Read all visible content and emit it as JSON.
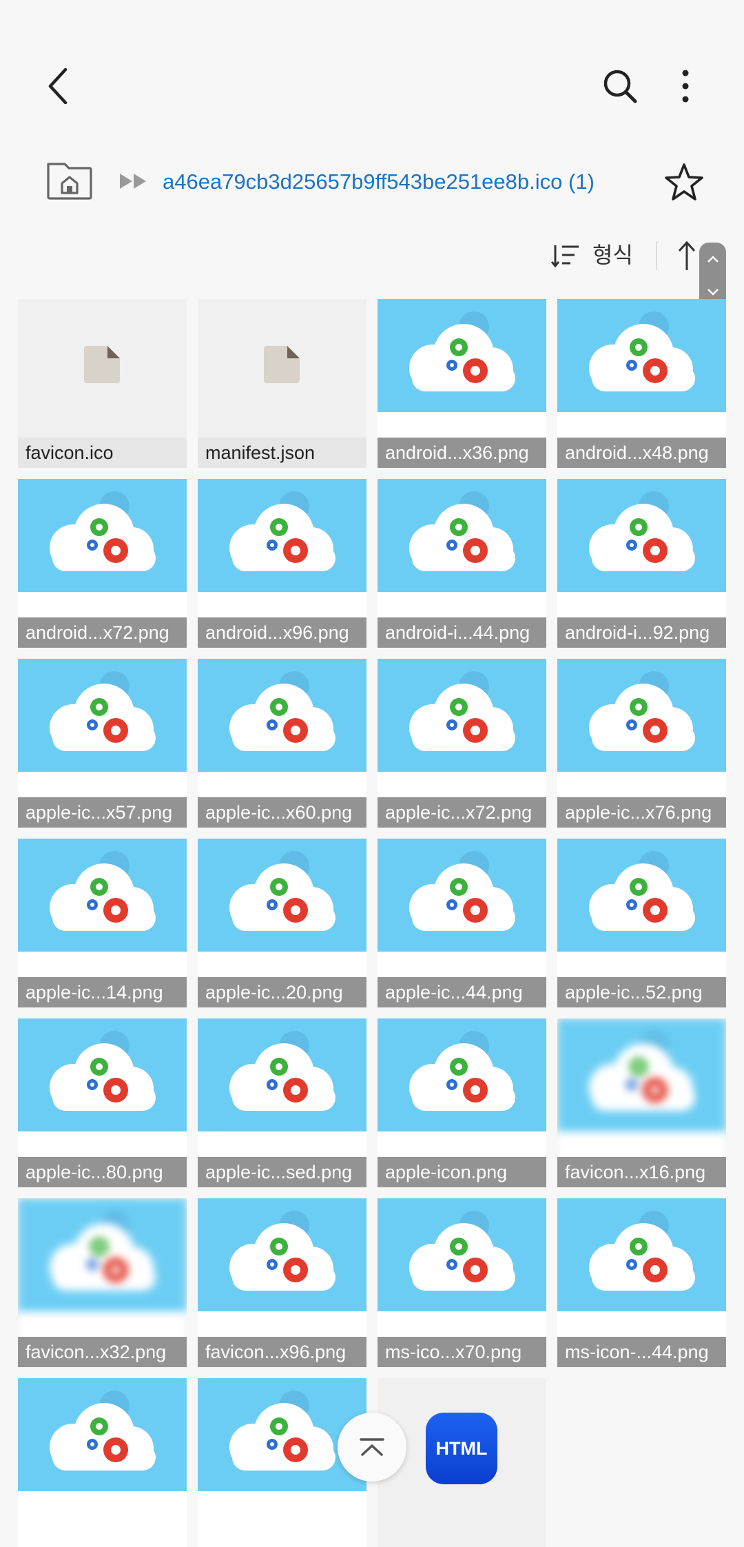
{
  "appbar": {
    "back_icon": "back-arrow-icon",
    "search_icon": "search-icon",
    "more_icon": "more-vertical-icon"
  },
  "path": {
    "home_icon": "home-folder-icon",
    "separator_icon": "double-chevron-right-icon",
    "current": "a46ea79cb3d25657b9ff543be251ee8b.ico (1)",
    "favorite_icon": "star-outline-icon"
  },
  "sort": {
    "label": "형식",
    "sort_icon": "sort-lines-icon",
    "direction_icon": "arrow-up-icon"
  },
  "colors": {
    "path_blue": "#1a73c8",
    "thumb_sky": "#6ccdf4",
    "label_bg": "#808080",
    "html_badge": "#1a55e8"
  },
  "files": [
    {
      "name": "favicon.ico",
      "kind": "doc"
    },
    {
      "name": "manifest.json",
      "kind": "doc"
    },
    {
      "name": "android...x36.png",
      "kind": "cloud"
    },
    {
      "name": "android...x48.png",
      "kind": "cloud"
    },
    {
      "name": "android...x72.png",
      "kind": "cloud"
    },
    {
      "name": "android...x96.png",
      "kind": "cloud"
    },
    {
      "name": "android-i...44.png",
      "kind": "cloud"
    },
    {
      "name": "android-i...92.png",
      "kind": "cloud"
    },
    {
      "name": "apple-ic...x57.png",
      "kind": "cloud"
    },
    {
      "name": "apple-ic...x60.png",
      "kind": "cloud"
    },
    {
      "name": "apple-ic...x72.png",
      "kind": "cloud"
    },
    {
      "name": "apple-ic...x76.png",
      "kind": "cloud"
    },
    {
      "name": "apple-ic...14.png",
      "kind": "cloud"
    },
    {
      "name": "apple-ic...20.png",
      "kind": "cloud"
    },
    {
      "name": "apple-ic...44.png",
      "kind": "cloud"
    },
    {
      "name": "apple-ic...52.png",
      "kind": "cloud"
    },
    {
      "name": "apple-ic...80.png",
      "kind": "cloud"
    },
    {
      "name": "apple-ic...sed.png",
      "kind": "cloud"
    },
    {
      "name": "apple-icon.png",
      "kind": "cloud"
    },
    {
      "name": "favicon...x16.png",
      "kind": "cloud-blur"
    },
    {
      "name": "favicon...x32.png",
      "kind": "cloud-blur"
    },
    {
      "name": "favicon...x96.png",
      "kind": "cloud"
    },
    {
      "name": "ms-ico...x70.png",
      "kind": "cloud"
    },
    {
      "name": "ms-icon-...44.png",
      "kind": "cloud"
    },
    {
      "name": "",
      "kind": "cloud"
    },
    {
      "name": "",
      "kind": "cloud"
    },
    {
      "name": "",
      "kind": "html"
    }
  ],
  "floating": {
    "scroll_top_icon": "scroll-to-top-icon",
    "html_badge_label": "HTML"
  }
}
